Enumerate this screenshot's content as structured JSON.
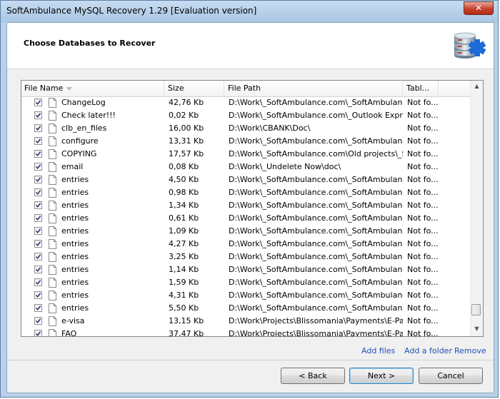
{
  "window": {
    "title": "SoftAmbulance MySQL Recovery 1.29 [Evaluation version]",
    "close_glyph": "✕"
  },
  "header": {
    "title": "Choose Databases to Recover",
    "logo_icon": "database-recovery-icon"
  },
  "table": {
    "columns": [
      "File Name",
      "Size",
      "File Path",
      "Tabl..."
    ],
    "sorted_column": "File Name",
    "rows": [
      {
        "name": "ChangeLog",
        "size": "42,76 Kb",
        "path": "D:\\Work\\_SoftAmbulance.com\\_SoftAmbulance ...",
        "tables": "Not fo...",
        "checked": true
      },
      {
        "name": "Check later!!!",
        "size": "0,02 Kb",
        "path": "D:\\Work\\_SoftAmbulance.com\\_Outlook Express\\",
        "tables": "Not fo...",
        "checked": true
      },
      {
        "name": "clb_en_files",
        "size": "16,00 Kb",
        "path": "D:\\Work\\CBANK\\Doc\\",
        "tables": "Not fo...",
        "checked": true
      },
      {
        "name": "configure",
        "size": "13,31 Kb",
        "path": "D:\\Work\\_SoftAmbulance.com\\_SoftAmbulance ...",
        "tables": "Not fo...",
        "checked": true
      },
      {
        "name": "COPYING",
        "size": "17,57 Kb",
        "path": "D:\\Work\\_SoftAmbulance.com\\Old projects\\_So...",
        "tables": "Not fo...",
        "checked": true
      },
      {
        "name": "email",
        "size": "0,08 Kb",
        "path": "D:\\Work\\_Undelete Now\\doc\\",
        "tables": "Not fo...",
        "checked": true
      },
      {
        "name": "entries",
        "size": "4,50 Kb",
        "path": "D:\\Work\\_SoftAmbulance.com\\_SoftAmbulance ...",
        "tables": "Not fo...",
        "checked": true
      },
      {
        "name": "entries",
        "size": "0,98 Kb",
        "path": "D:\\Work\\_SoftAmbulance.com\\_SoftAmbulance ...",
        "tables": "Not fo...",
        "checked": true
      },
      {
        "name": "entries",
        "size": "1,34 Kb",
        "path": "D:\\Work\\_SoftAmbulance.com\\_SoftAmbulance ...",
        "tables": "Not fo...",
        "checked": true
      },
      {
        "name": "entries",
        "size": "0,61 Kb",
        "path": "D:\\Work\\_SoftAmbulance.com\\_SoftAmbulance ...",
        "tables": "Not fo...",
        "checked": true
      },
      {
        "name": "entries",
        "size": "1,09 Kb",
        "path": "D:\\Work\\_SoftAmbulance.com\\_SoftAmbulance ...",
        "tables": "Not fo...",
        "checked": true
      },
      {
        "name": "entries",
        "size": "4,27 Kb",
        "path": "D:\\Work\\_SoftAmbulance.com\\_SoftAmbulance ...",
        "tables": "Not fo...",
        "checked": true
      },
      {
        "name": "entries",
        "size": "3,25 Kb",
        "path": "D:\\Work\\_SoftAmbulance.com\\_SoftAmbulance ...",
        "tables": "Not fo...",
        "checked": true
      },
      {
        "name": "entries",
        "size": "1,14 Kb",
        "path": "D:\\Work\\_SoftAmbulance.com\\_SoftAmbulance ...",
        "tables": "Not fo...",
        "checked": true
      },
      {
        "name": "entries",
        "size": "1,59 Kb",
        "path": "D:\\Work\\_SoftAmbulance.com\\_SoftAmbulance ...",
        "tables": "Not fo...",
        "checked": true
      },
      {
        "name": "entries",
        "size": "4,31 Kb",
        "path": "D:\\Work\\_SoftAmbulance.com\\_SoftAmbulance ...",
        "tables": "Not fo...",
        "checked": true
      },
      {
        "name": "entries",
        "size": "5,50 Kb",
        "path": "D:\\Work\\_SoftAmbulance.com\\_SoftAmbulance ...",
        "tables": "Not fo...",
        "checked": true
      },
      {
        "name": "e-visa",
        "size": "13,15 Kb",
        "path": "D:\\Work\\Projects\\Blissomania\\Payments\\E-Pass...",
        "tables": "Not fo...",
        "checked": true
      },
      {
        "name": "FAQ",
        "size": "37,47 Kb",
        "path": "D:\\Work\\Projects\\Blissomania\\Payments\\E-Pass...",
        "tables": "Not fo...",
        "checked": true
      }
    ]
  },
  "links": {
    "add_files": "Add files",
    "add_folder": "Add a folder",
    "remove": "Remove"
  },
  "buttons": {
    "back": "< Back",
    "next": "Next >",
    "cancel": "Cancel"
  },
  "colors": {
    "link": "#1f50b8",
    "title_bar": "#b9d1ea",
    "close_button": "#c8402c"
  }
}
